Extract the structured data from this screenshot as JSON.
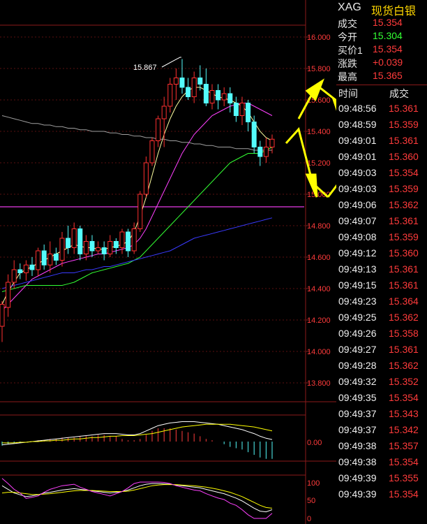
{
  "colors": {
    "axis_red": "#8b1a1a",
    "price_red": "#ff3b3b",
    "price_green": "#33ff33",
    "title_yellow": "#ffd700",
    "candle_up_red": "#ff3030",
    "candle_down_cyan": "#54fcfc",
    "arrow_yellow": "#ffff00"
  },
  "main_chart": {
    "price_axis_labels": [
      "16.000",
      "15.800",
      "15.600",
      "15.400",
      "15.200",
      "15.000",
      "14.800",
      "14.600",
      "14.400",
      "14.200",
      "14.000",
      "13.800"
    ],
    "high_annotation": "15.867"
  },
  "macd_panel": {
    "axis_label": "0.00"
  },
  "kdj_panel": {
    "axis_labels": [
      "100",
      "50",
      "0"
    ]
  },
  "quote_panel": {
    "symbol": "XAG",
    "name": "现货白银",
    "rows": [
      {
        "label": "成交",
        "value": "15.354",
        "color": "#ff3b3b"
      },
      {
        "label": "今开",
        "value": "15.304",
        "color": "#33ff33"
      },
      {
        "label": "买价1",
        "value": "15.354",
        "color": "#ff3b3b"
      },
      {
        "label": "涨跌",
        "value": "+0.039",
        "color": "#ff3b3b"
      },
      {
        "label": "最高",
        "value": "15.365",
        "color": "#ff3b3b"
      }
    ]
  },
  "ticks": {
    "header_time": "时间",
    "header_trade": "成交",
    "rows": [
      {
        "time": "09:48:56",
        "price": "15.361"
      },
      {
        "time": "09:48:59",
        "price": "15.359"
      },
      {
        "time": "09:49:01",
        "price": "15.361"
      },
      {
        "time": "09:49:01",
        "price": "15.360"
      },
      {
        "time": "09:49:03",
        "price": "15.354"
      },
      {
        "time": "09:49:03",
        "price": "15.359"
      },
      {
        "time": "09:49:06",
        "price": "15.362"
      },
      {
        "time": "09:49:07",
        "price": "15.361"
      },
      {
        "time": "09:49:08",
        "price": "15.359"
      },
      {
        "time": "09:49:12",
        "price": "15.360"
      },
      {
        "time": "09:49:13",
        "price": "15.361"
      },
      {
        "time": "09:49:15",
        "price": "15.361"
      },
      {
        "time": "09:49:23",
        "price": "15.364"
      },
      {
        "time": "09:49:25",
        "price": "15.362"
      },
      {
        "time": "09:49:26",
        "price": "15.358"
      },
      {
        "time": "09:49:27",
        "price": "15.361"
      },
      {
        "time": "09:49:28",
        "price": "15.362"
      },
      {
        "time": "09:49:32",
        "price": "15.352"
      },
      {
        "time": "09:49:35",
        "price": "15.354"
      },
      {
        "time": "09:49:37",
        "price": "15.343"
      },
      {
        "time": "09:49:37",
        "price": "15.342"
      },
      {
        "time": "09:49:38",
        "price": "15.357"
      },
      {
        "time": "09:49:38",
        "price": "15.354"
      },
      {
        "time": "09:49:39",
        "price": "15.355"
      },
      {
        "time": "09:49:39",
        "price": "15.354"
      }
    ]
  },
  "candles": [
    [
      14.16,
      14.3,
      14.32,
      14.06
    ],
    [
      14.28,
      14.44,
      14.49,
      14.22
    ],
    [
      14.44,
      14.52,
      14.58,
      14.4
    ],
    [
      14.52,
      14.5,
      14.56,
      14.46
    ],
    [
      14.5,
      14.55,
      14.58,
      14.45
    ],
    [
      14.55,
      14.52,
      14.6,
      14.48
    ],
    [
      14.52,
      14.64,
      14.66,
      14.48
    ],
    [
      14.64,
      14.55,
      14.68,
      14.52
    ],
    [
      14.55,
      14.62,
      14.7,
      14.5
    ],
    [
      14.62,
      14.58,
      14.66,
      14.55
    ],
    [
      14.58,
      14.72,
      14.76,
      14.54
    ],
    [
      14.72,
      14.66,
      14.8,
      14.62
    ],
    [
      14.66,
      14.78,
      14.82,
      14.62
    ],
    [
      14.78,
      14.62,
      14.8,
      14.58
    ],
    [
      14.62,
      14.7,
      14.74,
      14.58
    ],
    [
      14.7,
      14.64,
      14.74,
      14.6
    ],
    [
      14.64,
      14.66,
      14.7,
      14.62
    ],
    [
      14.66,
      14.62,
      14.7,
      14.58
    ],
    [
      14.62,
      14.7,
      14.74,
      14.6
    ],
    [
      14.7,
      14.66,
      14.72,
      14.62
    ],
    [
      14.66,
      14.76,
      14.78,
      14.62
    ],
    [
      14.76,
      14.64,
      14.78,
      14.6
    ],
    [
      14.64,
      14.78,
      14.82,
      14.62
    ],
    [
      14.78,
      15.0,
      15.02,
      14.76
    ],
    [
      15.0,
      15.2,
      15.24,
      14.98
    ],
    [
      15.2,
      15.34,
      15.36,
      15.18
    ],
    [
      15.34,
      15.48,
      15.5,
      15.3
    ],
    [
      15.48,
      15.56,
      15.62,
      15.3
    ],
    [
      15.56,
      15.7,
      15.74,
      15.52
    ],
    [
      15.7,
      15.74,
      15.8,
      15.6
    ],
    [
      15.74,
      15.68,
      15.86,
      15.64
    ],
    [
      15.68,
      15.62,
      15.74,
      15.6
    ],
    [
      15.62,
      15.74,
      15.78,
      15.58
    ],
    [
      15.74,
      15.7,
      15.82,
      15.66
    ],
    [
      15.7,
      15.58,
      15.8,
      15.56
    ],
    [
      15.58,
      15.66,
      15.7,
      15.54
    ],
    [
      15.66,
      15.6,
      15.7,
      15.54
    ],
    [
      15.6,
      15.64,
      15.68,
      15.56
    ],
    [
      15.64,
      15.58,
      15.68,
      15.52
    ],
    [
      15.58,
      15.5,
      15.62,
      15.46
    ],
    [
      15.5,
      15.58,
      15.62,
      15.44
    ],
    [
      15.58,
      15.46,
      15.6,
      15.4
    ],
    [
      15.46,
      15.3,
      15.5,
      15.26
    ],
    [
      15.3,
      15.24,
      15.34,
      15.18
    ],
    [
      15.24,
      15.3,
      15.36,
      15.2
    ],
    [
      15.3,
      15.35,
      15.38,
      15.26
    ]
  ],
  "moving_averages": [
    {
      "color": "#ffffa0",
      "values": [
        14.3,
        14.38,
        14.44,
        14.5,
        14.52,
        14.54,
        14.56,
        14.58,
        14.6,
        14.62,
        14.64,
        14.66,
        14.68,
        14.67,
        14.66,
        14.66,
        14.65,
        14.65,
        14.66,
        14.67,
        14.68,
        14.7,
        14.76,
        14.86,
        14.98,
        15.12,
        15.26,
        15.38,
        15.48,
        15.56,
        15.62,
        15.66,
        15.68,
        15.68,
        15.66,
        15.64,
        15.62,
        15.61,
        15.6,
        15.58,
        15.56,
        15.52,
        15.46,
        15.4,
        15.36,
        15.34
      ]
    },
    {
      "color": "#ff40ff",
      "values": [
        14.26,
        14.3,
        14.34,
        14.38,
        14.42,
        14.46,
        14.48,
        14.5,
        14.52,
        14.54,
        14.56,
        14.57,
        14.58,
        14.59,
        14.6,
        14.61,
        14.62,
        14.62,
        14.63,
        14.64,
        14.65,
        14.66,
        14.68,
        14.72,
        14.78,
        14.86,
        14.94,
        15.02,
        15.1,
        15.18,
        15.26,
        15.32,
        15.38,
        15.42,
        15.46,
        15.5,
        15.52,
        15.54,
        15.56,
        15.57,
        15.58,
        15.58,
        15.56,
        15.54,
        15.52,
        15.5
      ]
    },
    {
      "color": "#33ff33",
      "values": [
        14.38,
        14.39,
        14.4,
        14.41,
        14.42,
        14.42,
        14.42,
        14.42,
        14.42,
        14.42,
        14.42,
        14.43,
        14.44,
        14.46,
        14.48,
        14.5,
        14.51,
        14.52,
        14.53,
        14.54,
        14.55,
        14.56,
        14.58,
        14.6,
        14.64,
        14.68,
        14.72,
        14.76,
        14.8,
        14.84,
        14.88,
        14.92,
        14.96,
        15.0,
        15.04,
        15.08,
        15.12,
        15.16,
        15.2,
        15.22,
        15.24,
        15.26,
        15.26,
        15.26,
        15.28,
        15.3
      ]
    },
    {
      "color": "#3a3aff",
      "values": [
        14.4,
        14.41,
        14.42,
        14.43,
        14.44,
        14.45,
        14.46,
        14.47,
        14.48,
        14.49,
        14.5,
        14.5,
        14.5,
        14.51,
        14.52,
        14.52,
        14.53,
        14.54,
        14.54,
        14.55,
        14.56,
        14.57,
        14.58,
        14.59,
        14.6,
        14.61,
        14.62,
        14.63,
        14.64,
        14.66,
        14.68,
        14.7,
        14.72,
        14.73,
        14.74,
        14.75,
        14.76,
        14.77,
        14.78,
        14.79,
        14.8,
        14.81,
        14.82,
        14.83,
        14.84,
        14.85
      ]
    },
    {
      "color": "#a0a0a0",
      "values": [
        15.5,
        15.49,
        15.48,
        15.47,
        15.46,
        15.45,
        15.45,
        15.44,
        15.44,
        15.43,
        15.43,
        15.42,
        15.42,
        15.41,
        15.41,
        15.4,
        15.4,
        15.4,
        15.39,
        15.39,
        15.38,
        15.38,
        15.37,
        15.37,
        15.36,
        15.36,
        15.35,
        15.35,
        15.34,
        15.34,
        15.33,
        15.33,
        15.32,
        15.32,
        15.31,
        15.31,
        15.3,
        15.3,
        15.3,
        15.29,
        15.29,
        15.29,
        15.28,
        15.28,
        15.28,
        15.28
      ]
    }
  ],
  "flat_line": {
    "color": "#c030c0",
    "value": 14.92
  },
  "macd": {
    "dif": [
      -0.05,
      -0.04,
      -0.03,
      -0.02,
      -0.01,
      0.0,
      0.01,
      0.02,
      0.03,
      0.04,
      0.05,
      0.06,
      0.07,
      0.08,
      0.09,
      0.1,
      0.11,
      0.12,
      0.12,
      0.12,
      0.11,
      0.1,
      0.1,
      0.12,
      0.16,
      0.2,
      0.24,
      0.26,
      0.28,
      0.29,
      0.3,
      0.3,
      0.3,
      0.29,
      0.28,
      0.27,
      0.26,
      0.24,
      0.22,
      0.2,
      0.18,
      0.15,
      0.12,
      0.08,
      0.05,
      0.03
    ],
    "dea": [
      -0.02,
      -0.02,
      -0.02,
      -0.01,
      -0.01,
      0.0,
      0.0,
      0.01,
      0.01,
      0.02,
      0.02,
      0.03,
      0.04,
      0.04,
      0.05,
      0.06,
      0.06,
      0.07,
      0.08,
      0.08,
      0.09,
      0.09,
      0.09,
      0.1,
      0.11,
      0.12,
      0.14,
      0.16,
      0.18,
      0.2,
      0.22,
      0.23,
      0.24,
      0.25,
      0.26,
      0.26,
      0.26,
      0.26,
      0.26,
      0.25,
      0.24,
      0.23,
      0.22,
      0.2,
      0.18,
      0.16
    ]
  },
  "kdj": {
    "k": [
      90,
      80,
      70,
      65,
      60,
      62,
      65,
      70,
      72,
      75,
      78,
      80,
      82,
      80,
      78,
      76,
      74,
      72,
      70,
      72,
      74,
      78,
      84,
      90,
      94,
      96,
      96,
      95,
      94,
      92,
      90,
      88,
      86,
      84,
      80,
      76,
      72,
      68,
      62,
      56,
      48,
      38,
      28,
      20,
      18,
      24
    ],
    "d": [
      70,
      72,
      72,
      70,
      68,
      66,
      66,
      67,
      68,
      70,
      72,
      74,
      76,
      77,
      77,
      77,
      76,
      75,
      74,
      74,
      74,
      75,
      78,
      82,
      86,
      90,
      92,
      93,
      93,
      93,
      92,
      91,
      90,
      88,
      86,
      83,
      80,
      76,
      72,
      66,
      60,
      52,
      44,
      36,
      30,
      28
    ],
    "j": [
      110,
      96,
      80,
      70,
      55,
      58,
      62,
      72,
      80,
      85,
      90,
      92,
      94,
      86,
      80,
      74,
      70,
      66,
      62,
      68,
      74,
      84,
      96,
      100,
      100,
      100,
      100,
      99,
      96,
      90,
      86,
      82,
      78,
      76,
      68,
      62,
      56,
      52,
      42,
      36,
      24,
      10,
      0,
      0,
      0,
      14
    ]
  }
}
